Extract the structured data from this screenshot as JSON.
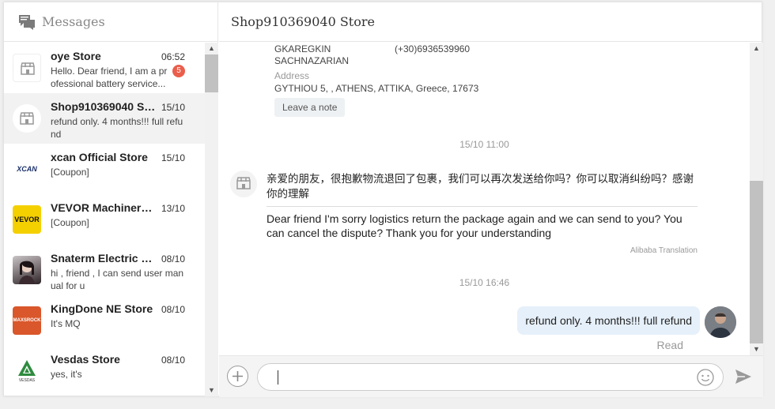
{
  "left_panel": {
    "title": "Messages",
    "conversations": [
      {
        "name": "oye Store",
        "date": "06:52",
        "preview": "Hello. Dear friend, I am a professional battery service...",
        "badge": "5",
        "avatar": "store-default"
      },
      {
        "name": "Shop910369040 Store",
        "date": "15/10",
        "preview": "refund only. 4 months!!! full refund",
        "avatar": "store-default"
      },
      {
        "name": "xcan Official Store",
        "date": "15/10",
        "preview": "[Coupon]",
        "avatar": "xcan-logo",
        "avatar_text": "XCAN"
      },
      {
        "name": "VEVOR Machinery Store",
        "date": "13/10",
        "preview": "[Coupon]",
        "avatar": "vevor-logo",
        "avatar_text": "VEVOR"
      },
      {
        "name": "Snaterm Electric Store",
        "date": "08/10",
        "preview": "hi , friend , I can send user manual for u",
        "avatar": "person-photo"
      },
      {
        "name": "KingDone NE Store",
        "date": "08/10",
        "preview": "It's MQ",
        "avatar": "maxsrock-logo",
        "avatar_text": "MAXSROCK"
      },
      {
        "name": "Vesdas Store",
        "date": "08/10",
        "preview": "yes, it's",
        "avatar": "vesdas-logo",
        "avatar_text": "VESDAS"
      }
    ]
  },
  "right_panel": {
    "title": "Shop910369040 Store",
    "address_card": {
      "name": "GKAREGKIN\nSACHNAZARIAN",
      "phone": "(+30)6936539960",
      "address_label": "Address",
      "address": "GYTHIOU 5, , ATHENS, ATTIKA, Greece, 17673",
      "note_button": "Leave a note"
    },
    "messages": [
      {
        "type": "timestamp",
        "text": "15/10 11:00"
      },
      {
        "type": "incoming",
        "original": "亲爱的朋友，很抱歉物流退回了包裹，我们可以再次发送给你吗？你可以取消纠纷吗？感谢你的理解",
        "translation": "Dear friend I'm sorry logistics return the package again and we can send to you? You can cancel the dispute? Thank you for your understanding",
        "translation_source": "Alibaba Translation"
      },
      {
        "type": "timestamp",
        "text": "15/10 16:46"
      },
      {
        "type": "outgoing",
        "text": "refund only. 4 months!!! full refund",
        "status": "Read"
      }
    ]
  },
  "composer": {
    "input_value": "",
    "placeholder": ""
  },
  "colors": {
    "badge": "#ea5e4b",
    "outgoing_bubble": "#e6f0fa",
    "active_row": "#f2f2f2"
  }
}
